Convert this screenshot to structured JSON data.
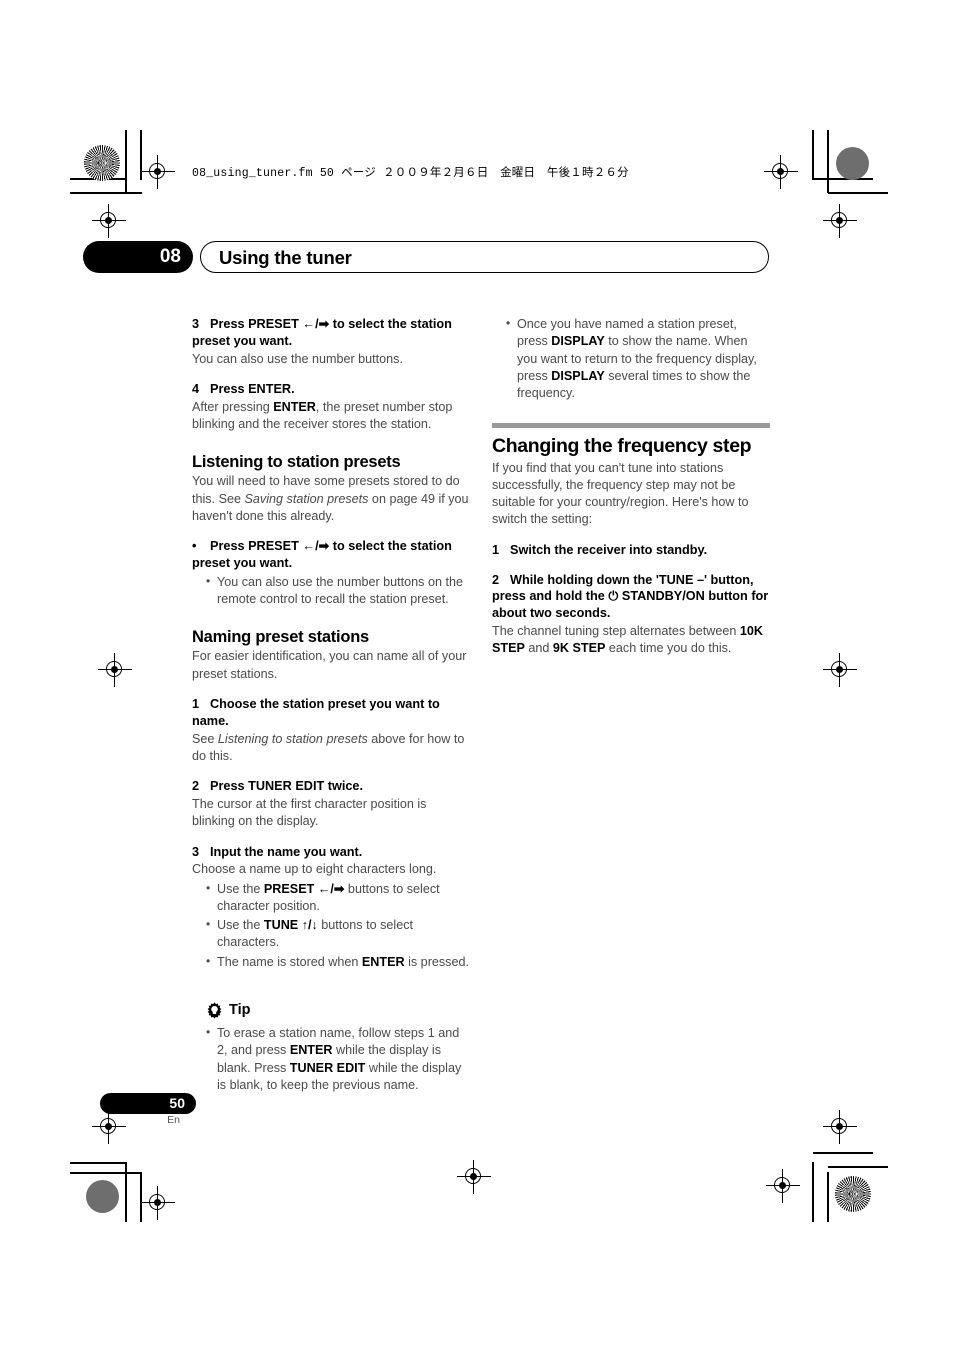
{
  "page": {
    "filestamp": "08_using_tuner.fm  50 ページ  ２００９年２月６日　金曜日　午後１時２６分",
    "chapter_number": "08",
    "chapter_title": "Using the tuner",
    "page_number": "50",
    "page_language": "En"
  },
  "left_column": {
    "step3_heading_num": "3",
    "step3_heading": "Press PRESET ←/➡ to select the station preset you want.",
    "step3_body": "You can also use the number buttons.",
    "step4_heading_num": "4",
    "step4_heading": "Press ENTER.",
    "step4_body_pre": "After pressing ",
    "step4_body_bold": "ENTER",
    "step4_body_post": ", the preset number stop blinking and the receiver stores the station.",
    "listening_heading": "Listening to station presets",
    "listening_body_pre": "You will need to have some presets stored to do this. See ",
    "listening_body_italic": "Saving station presets",
    "listening_body_post": " on page 49 if you haven't done this already.",
    "listening_bullet": "Press PRESET ←/➡ to select the station preset you want.",
    "listening_subbullet": "You can also use the number buttons on the remote control to recall the station preset.",
    "naming_heading": "Naming preset stations",
    "naming_body": "For easier identification, you can name all of your preset stations.",
    "name_step1_num": "1",
    "name_step1_heading": "Choose the station preset you want to name.",
    "name_step1_body_pre": "See ",
    "name_step1_body_italic": "Listening to station presets",
    "name_step1_body_post": " above for how to do this.",
    "name_step2_num": "2",
    "name_step2_heading": "Press TUNER EDIT twice.",
    "name_step2_body": "The cursor at the first character position is blinking on the display.",
    "name_step3_num": "3",
    "name_step3_heading": "Input the name you want.",
    "name_step3_body": "Choose a name up to eight characters long.",
    "name_step3_b1_pre": "Use the ",
    "name_step3_b1_bold": "PRESET ←/➡",
    "name_step3_b1_post": " buttons to select character position.",
    "name_step3_b2_pre": "Use the ",
    "name_step3_b2_bold": "TUNE ↑/↓",
    "name_step3_b2_post": " buttons to select characters.",
    "name_step3_b3_pre": "The name is stored when ",
    "name_step3_b3_bold": "ENTER",
    "name_step3_b3_post": " is pressed.",
    "tip_label": "Tip",
    "tip_icon": "gear-lightbulb-icon",
    "tip_text_1": "To erase a station name, follow steps 1 and 2, and press ",
    "tip_bold_1": "ENTER",
    "tip_text_2": " while the display is blank. Press ",
    "tip_bold_2": "TUNER EDIT",
    "tip_text_3": " while the display is blank, to keep the previous name."
  },
  "right_column": {
    "bullet_pre": "Once you have named a station preset, press ",
    "bullet_bold_1": "DISPLAY",
    "bullet_mid": " to show the name.  When you want to return to the frequency display, press ",
    "bullet_bold_2": "DISPLAY",
    "bullet_post": " several times to show the frequency.",
    "section_heading": "Changing the frequency step",
    "section_body": "If you find that you can't tune into stations successfully, the frequency step may not be suitable for your country/region. Here's how to switch the setting:",
    "step1_num": "1",
    "step1_heading": "Switch the receiver into standby.",
    "step2_num": "2",
    "step2_heading": "While holding down the 'TUNE –' button, press and hold the ⏻ STANDBY/ON button for about two seconds.",
    "step2_body_pre": "The channel tuning step alternates between ",
    "step2_body_bold_1": "10K STEP",
    "step2_body_mid": " and ",
    "step2_body_bold_2": "9K STEP",
    "step2_body_post": " each time you do this."
  },
  "colors": {
    "text": "#3f3f3f",
    "heading": "#000000",
    "rule": "#9a9a9a",
    "pill": "#000000"
  }
}
